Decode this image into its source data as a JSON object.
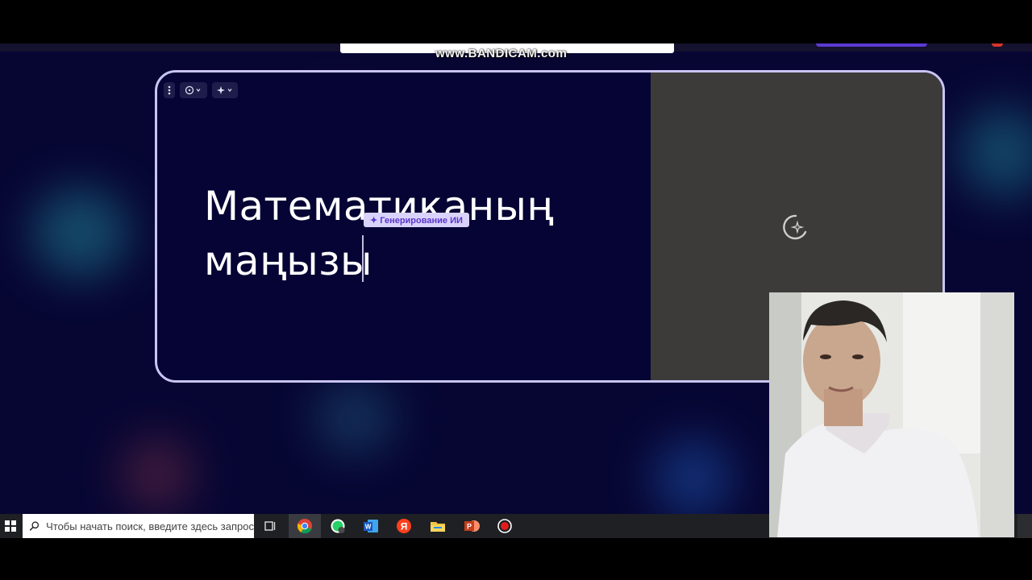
{
  "watermark": "www.BANDICAM.com",
  "slide": {
    "title_line1": "Математиканың",
    "title_line2": "маңызы",
    "ai_badge": "✦ Генерирование ИИ"
  },
  "taskbar": {
    "search_placeholder": "Чтобы начать поиск, введите здесь запрос",
    "apps": [
      "task-view",
      "chrome",
      "whatsapp",
      "word",
      "yandex",
      "file-explorer",
      "powerpoint",
      "bandicam-record"
    ]
  },
  "colors": {
    "background": "#070633",
    "card_border": "#c9c4f2",
    "image_panel": "#3d3b3a",
    "ai_badge_bg": "#d9d2fb",
    "ai_badge_text": "#5a36c9"
  }
}
